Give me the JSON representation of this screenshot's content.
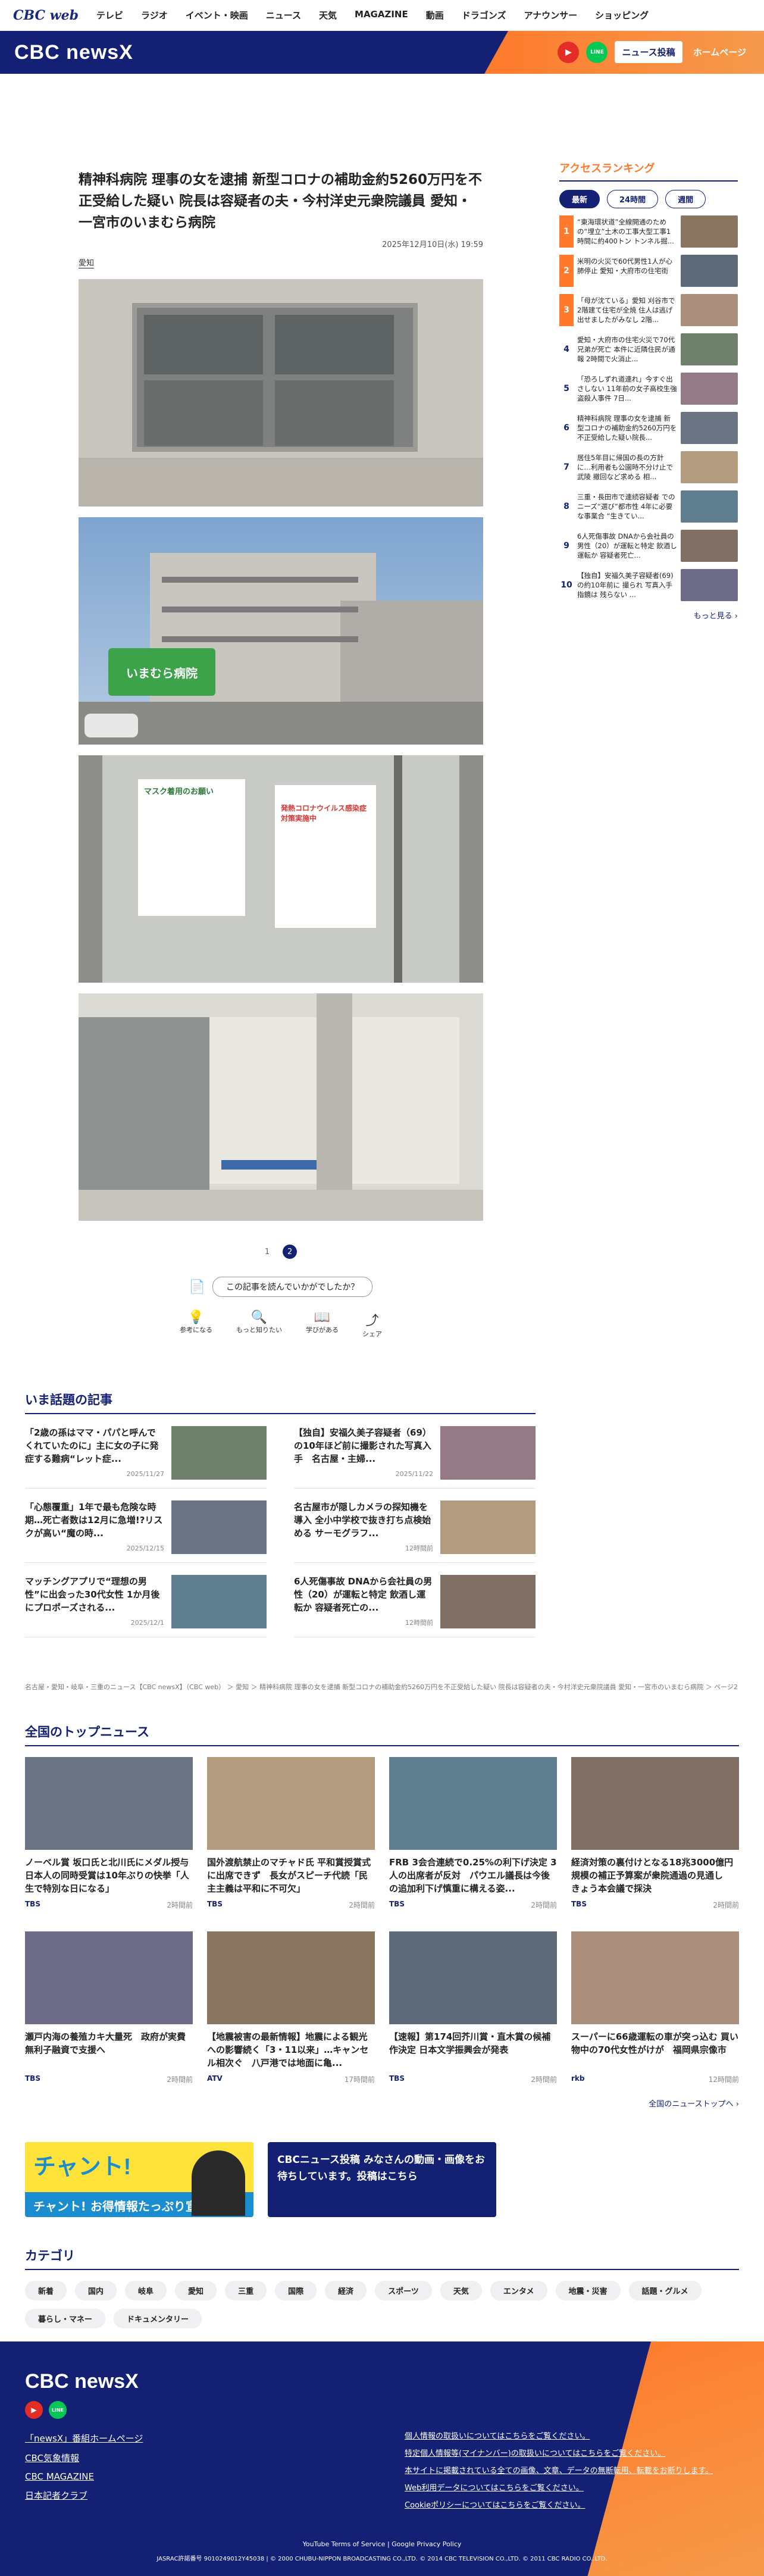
{
  "topnav": {
    "logo": "CBC web",
    "items": [
      "テレビ",
      "ラジオ",
      "イベント・映画",
      "ニュース",
      "天気",
      "MAGAZINE",
      "動画",
      "ドラゴンズ",
      "アナウンサー",
      "ショッピング"
    ]
  },
  "brand": {
    "logo": "CBC newsX",
    "post": "ニュース投稿",
    "home": "ホームページ",
    "youtube": "▶",
    "line": "LINE"
  },
  "article": {
    "title": "精神科病院 理事の女を逮捕 新型コロナの補助金約5260万円を不正受給した疑い 院長は容疑者の夫・今村洋史元衆院議員 愛知・一宮市のいまむら病院",
    "date": "2025年12月10日(水) 19:59",
    "tag": "愛知",
    "pages": [
      "1",
      "2"
    ],
    "survey": "この記事を読んでいかがでしたか？",
    "reactions": [
      "参考になる",
      "もっと知りたい",
      "学びがある",
      "シェア"
    ]
  },
  "sign": {
    "hospital": "いまむら病院",
    "notice1": "マスク着用のお願い",
    "notice2": "発熱コロナウイルス感染症 対策実施中"
  },
  "ranking": {
    "title": "アクセスランキング",
    "tabs": [
      "最新",
      "24時間",
      "週間"
    ],
    "items": [
      "“東海環状道”全線開通のための“埋立”土木の工事大型工事1時間に約400トン トンネル掘...",
      "米明の火災で60代男性1人が心肺停止 愛知・大府市の住宅街",
      "「母が沈ている」愛知 刈谷市で2階建て住宅が全焼 住人は逃げ出せましたがみなし 2階...",
      "愛知・大府市の住宅火災で70代兄弟が死亡 本件に近隣住民が通報 2時間で火消止...",
      "「恐ろしずれ道連れ」今すぐ出さしない 11年前の女子高校生強盗殺人事件 7日...",
      "精神科病院 理事の女を逮捕 新型コロナの補助金約5260万円を不正受給した疑い院長...",
      "居住5年目に帰国の長の方針に…利用者も公園時不分け止で武陵 撤回など求める 相...",
      "三重・長田市で連続容疑者 でのニーズ“選び”都市性 4年に必要な事業合 “生きてい...",
      "6人死傷事故 DNAから会社員の男性（20）が運転と特定 飲酒し運転か 容疑者死亡...",
      "【独自】安福久美子容疑者(69)の約10年前に 撮られ 写真入手 指鏡は 残らない ..."
    ],
    "more": "もっと見る"
  },
  "trend": {
    "title": "いま話題の記事",
    "items": [
      {
        "t": "「2歳の孫はママ・パパと呼んでくれていたのに」主に女の子に発症する難病“レット症...",
        "d": "2025/11/27"
      },
      {
        "t": "【独自】安福久美子容疑者（69）の10年ほど前に撮影された写真入手　名古屋・主婦...",
        "d": "2025/11/22"
      },
      {
        "t": "「心態覆重」1年で最も危険な時期…死亡者数は12月に急増!?リスクが高い“魔の時...",
        "d": "2025/12/15"
      },
      {
        "t": "名古屋市が隠しカメラの探知機を導入 全小中学校で抜き打ち点検始める サーモグラフ...",
        "d": "12時間前"
      },
      {
        "t": "マッチングアプリで“理想の男性”に出会った30代女性 1か月後にプロポーズされる...",
        "d": "2025/12/1"
      },
      {
        "t": "6人死傷事故 DNAから会社員の男性（20）が運転と特定 飲酒し運転か 容疑者死亡の...",
        "d": "12時間前"
      }
    ]
  },
  "breadcrumb": "名古屋・愛知・岐阜・三重のニュース【CBC newsX】（CBC web） ＞ 愛知 ＞ 精神科病院 理事の女を逮捕 新型コロナの補助金約5260万円を不正受給した疑い 院長は容疑者の夫・今村洋史元衆院議員 愛知・一宮市のいまむら病院 ＞ ページ2",
  "top": {
    "title": "全国のトップニュース",
    "items": [
      {
        "t": "ノーベル賞 坂口氏と北川氏にメダル授与 日本人の同時受賞は10年ぶりの快挙「人生で特別な日になる」",
        "s": "TBS",
        "d": "2時間前"
      },
      {
        "t": "国外渡航禁止のマチャド氏 平和賞授賞式に出席できず　長女がスピーチ代読「民主主義は平和に不可欠」",
        "s": "TBS",
        "d": "2時間前"
      },
      {
        "t": "FRB 3会合連続で0.25%の利下げ決定 3人の出席者が反対　パウエル議長は今後の追加利下げ慎重に構える姿...",
        "s": "TBS",
        "d": "2時間前"
      },
      {
        "t": "経済対策の裏付けとなる18兆3000億円規模の補正予算案が衆院通過の見通し　きょう本会議で採決",
        "s": "TBS",
        "d": "2時間前"
      },
      {
        "t": "瀬戸内海の養殖カキ大量死　政府が実費無利子融資で支援へ",
        "s": "TBS",
        "d": "2時間前"
      },
      {
        "t": "【地震被害の最新情報】地震による観光への影響続く「3・11以来」…キャンセル相次ぐ　八戸港では地面に亀...",
        "s": "ATV",
        "d": "17時間前"
      },
      {
        "t": "【速報】第174回芥川賞・直木賞の候補作決定 日本文学振興会が発表",
        "s": "TBS",
        "d": "2時間前"
      },
      {
        "t": "スーパーに66歳運転の車が突っ込む 買い物中の70代女性がけが　福岡県宗像市",
        "s": "rkb",
        "d": "12時間前"
      }
    ],
    "more": "全国のニューストップへ"
  },
  "banners": {
    "b1": "チャント! お得情報たっぷり宣言",
    "b2": "CBCニュース投稿 みなさんの動画・画像をお待ちしています。投稿はこちら"
  },
  "categories": {
    "title": "カテゴリ",
    "items": [
      "新着",
      "国内",
      "岐阜",
      "愛知",
      "三重",
      "国際",
      "経済",
      "スポーツ",
      "天気",
      "エンタメ",
      "地震・災害",
      "話題・グルメ",
      "暮らし・マネー",
      "ドキュメンタリー"
    ]
  },
  "footer": {
    "logo": "CBC newsX",
    "links": [
      "「newsX」番組ホームページ",
      "CBC気象情報",
      "CBC MAGAZINE",
      "日本記者クラブ"
    ],
    "policy": [
      "個人情報の取扱いについてはこちらをご覧ください。",
      "特定個人情報等(マイナンバー)の取扱いについてはこちらをご覧ください。",
      "本サイトに掲載されている全ての画像、文章、データの無断転用、転載をお断りします。",
      "Web利用データについてはこちらをご覧ください。",
      "Cookieポリシーについてはこちらをご覧ください。"
    ],
    "terms": "YouTube Terms of Service | Google Privacy Policy",
    "copy": "JASRAC許諾番号 9010249012Y45038 | © 2000 CHUBU-NIPPON BROADCASTING CO.,LTD. © 2014 CBC TELEVISION CO.,LTD. © 2011 CBC RADIO CO.,LTD."
  },
  "colors": {
    "navy": "#142074",
    "orange": "#ff7a2c"
  }
}
